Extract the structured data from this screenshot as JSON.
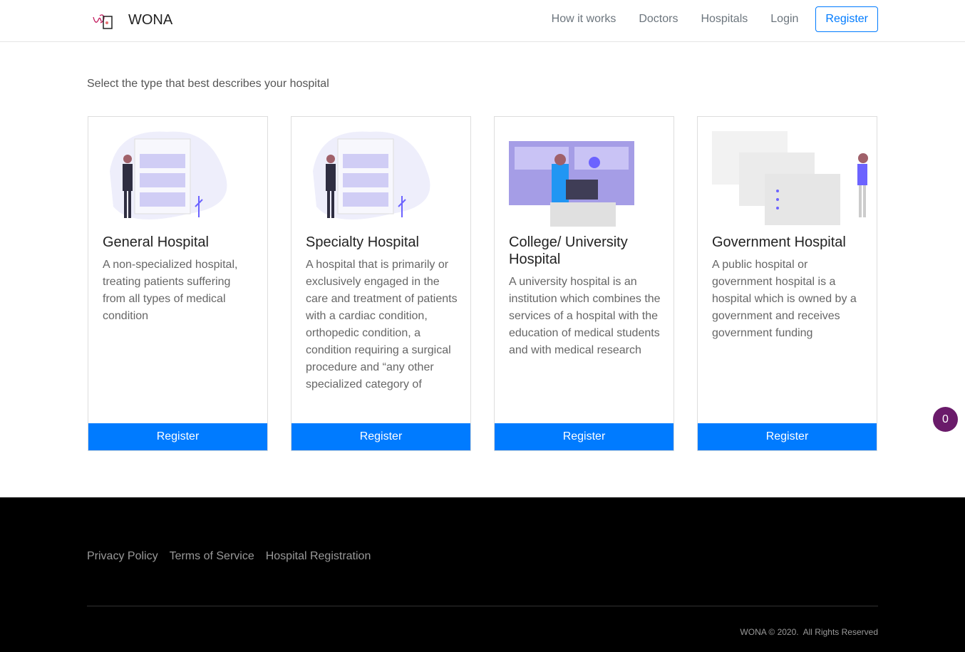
{
  "nav": {
    "brand": "WONA",
    "links": [
      "How it works",
      "Doctors",
      "Hospitals",
      "Login"
    ],
    "register": "Register"
  },
  "lead": "Select the type that best describes your hospital",
  "cards": [
    {
      "title": "General Hospital",
      "desc": "A non-specialized hospital, treating patients suffering from all types of medical condition",
      "button": "Register"
    },
    {
      "title": "Specialty Hospital",
      "desc": "A hospital that is primarily or exclusively engaged in the care and treatment of patients with a cardiac condition, orthopedic condition, a condition requiring a surgical procedure and “any other specialized category of",
      "button": "Register"
    },
    {
      "title": "College/ University Hospital",
      "desc": "A university hospital is an institution which combines the services of a hospital with the education of medical students and with medical research",
      "button": "Register"
    },
    {
      "title": "Government Hospital",
      "desc": "A public hospital or government hospital is a hospital which is owned by a government and receives government funding",
      "button": "Register"
    }
  ],
  "badge": "0",
  "footer": {
    "links": [
      "Privacy Policy",
      "Terms of Service",
      "Hospital Registration"
    ],
    "copyright": "WONA © 2020.  All Rights Reserved"
  }
}
